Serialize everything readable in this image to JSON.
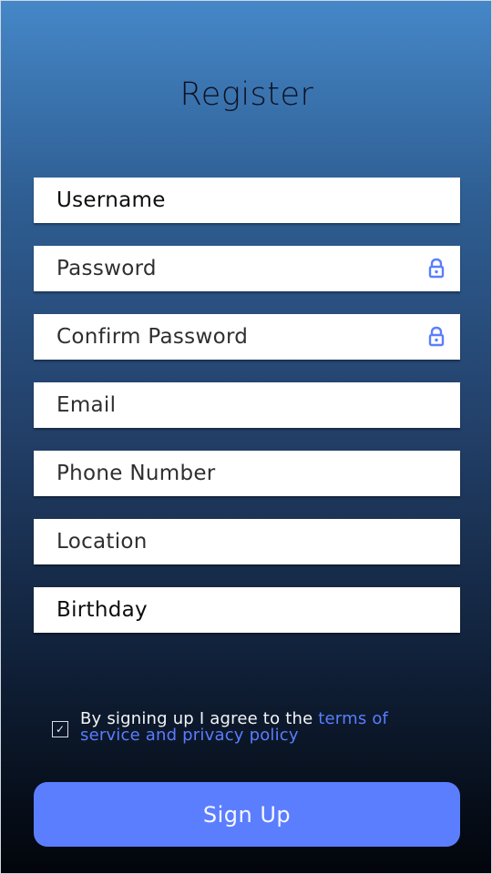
{
  "title": "Register",
  "fields": [
    {
      "label": "Username",
      "icon": null
    },
    {
      "label": "Password",
      "icon": "lock-icon"
    },
    {
      "label": "Confirm Password",
      "icon": "lock-icon"
    },
    {
      "label": "Email",
      "icon": null
    },
    {
      "label": "Phone Number",
      "icon": null
    },
    {
      "label": "Location",
      "icon": null
    },
    {
      "label": "Birthday",
      "icon": null
    }
  ],
  "agreement": {
    "checked": true,
    "text": "By signing up I agree to the ",
    "link_text": "terms of service and privacy policy"
  },
  "button": {
    "label": "Sign Up"
  },
  "colors": {
    "accent": "#5b7eff",
    "field_background": "#ffffff",
    "title_text": "#0d1020",
    "gradient_top": "#4587c8",
    "gradient_bottom": "#02050b"
  }
}
